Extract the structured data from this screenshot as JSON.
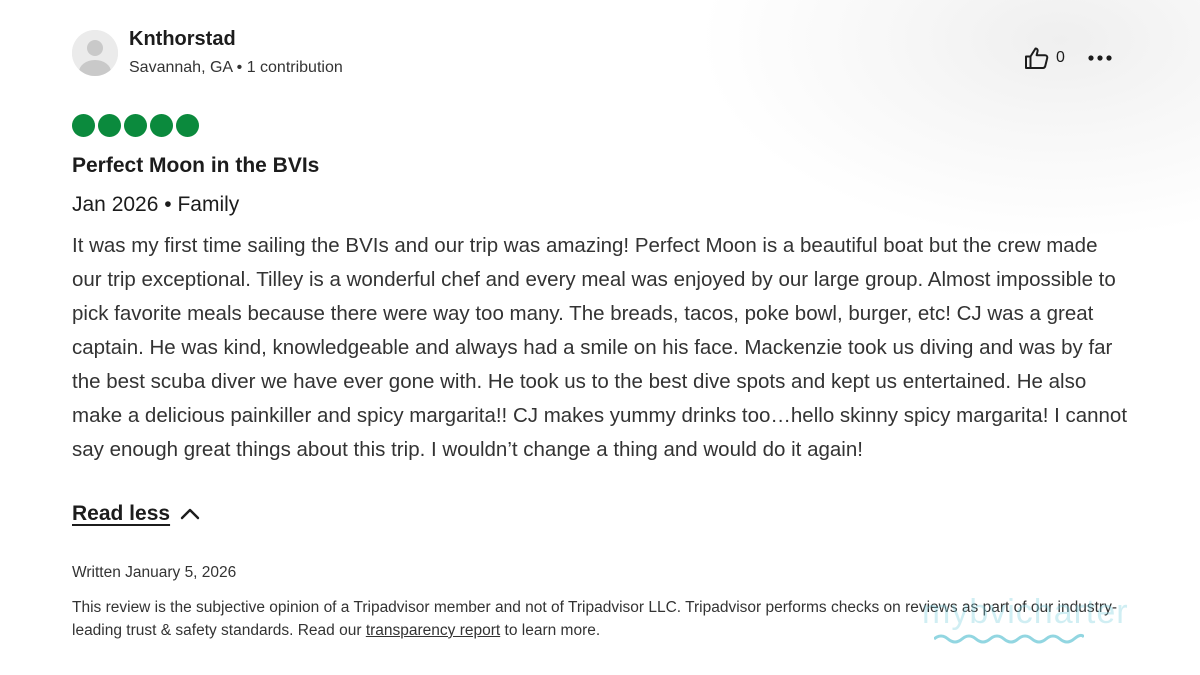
{
  "reviewer": {
    "name": "Knthorstad",
    "location": "Savannah, GA",
    "contributions": "1 contribution",
    "meta_separator": " • "
  },
  "helpful": {
    "count": "0",
    "icon": "thumbs-up-icon"
  },
  "more_options": {
    "icon": "more-horizontal-icon"
  },
  "rating": {
    "value": 5,
    "max": 5,
    "color": "#0b8a3d"
  },
  "review": {
    "title": "Perfect Moon in the BVIs",
    "trip_date": "Jan 2026",
    "trip_type": "Family",
    "trip_separator": " • ",
    "body": "It was my first time sailing the BVIs and our trip was amazing! Perfect Moon is a beautiful boat but the crew made our trip exceptional. Tilley is a wonderful chef and every meal was enjoyed by our large group. Almost impossible to pick favorite meals because there were way too many. The breads, tacos, poke bowl, burger, etc! CJ was a great captain. He was kind, knowledgeable and always had a smile on his face. Mackenzie took us diving and was by far the best scuba diver we have ever gone with. He took us to the best dive spots and kept us entertained. He also make a delicious painkiller and spicy margarita!! CJ makes yummy drinks too…hello skinny spicy margarita! I cannot say enough great things about this trip. I wouldn’t change a thing and would do it again!",
    "read_less_label": "Read less",
    "read_less_icon": "chevron-up-icon",
    "written_date": "Written January 5, 2026"
  },
  "disclaimer": {
    "text_before": "This review is the subjective opinion of a Tripadvisor member and not of Tripadvisor LLC. Tripadvisor performs checks on reviews as part of our industry-leading trust & safety standards. Read our ",
    "link_text": "transparency report",
    "text_after": " to learn more."
  },
  "watermark": {
    "text": "mybvicharter",
    "color": "#78cddc"
  }
}
